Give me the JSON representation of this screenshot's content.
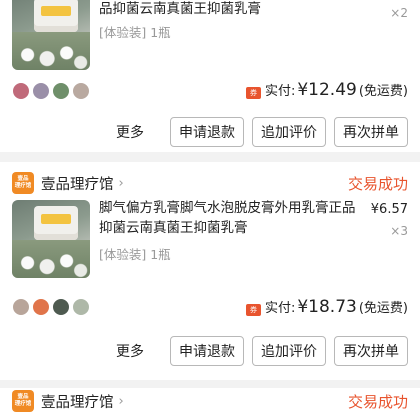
{
  "orders": [
    {
      "shop_name": "",
      "status": "",
      "title": "品抑菌云南真菌王抑菌乳膏",
      "sku": "[体验装] 1瓶",
      "price": "",
      "quantity": "×2",
      "paid_label": "实付:",
      "paid_amount": "¥12.49",
      "shipping_note": "(免运费)",
      "buttons": [
        "更多",
        "申请退款",
        "追加评价",
        "再次拼单"
      ]
    },
    {
      "shop_name": "壹品理疗馆",
      "status": "交易成功",
      "title": "脚气偏方乳膏脚气水泡脱皮膏外用乳膏正品抑菌云南真菌王抑菌乳膏",
      "sku": "[体验装] 1瓶",
      "price": "¥6.57",
      "quantity": "×3",
      "paid_label": "实付:",
      "paid_amount": "¥18.73",
      "shipping_note": "(免运费)",
      "buttons": [
        "更多",
        "申请退款",
        "追加评价",
        "再次拼单"
      ]
    },
    {
      "shop_name": "壹品理疗馆",
      "status": "交易成功"
    }
  ],
  "shop_logo_text": [
    "壹品",
    "理疗馆"
  ],
  "discount_badge": "券",
  "colors": {
    "accent": "#e8542e",
    "logo": "#f08a24",
    "background": "#f2f2f2"
  }
}
